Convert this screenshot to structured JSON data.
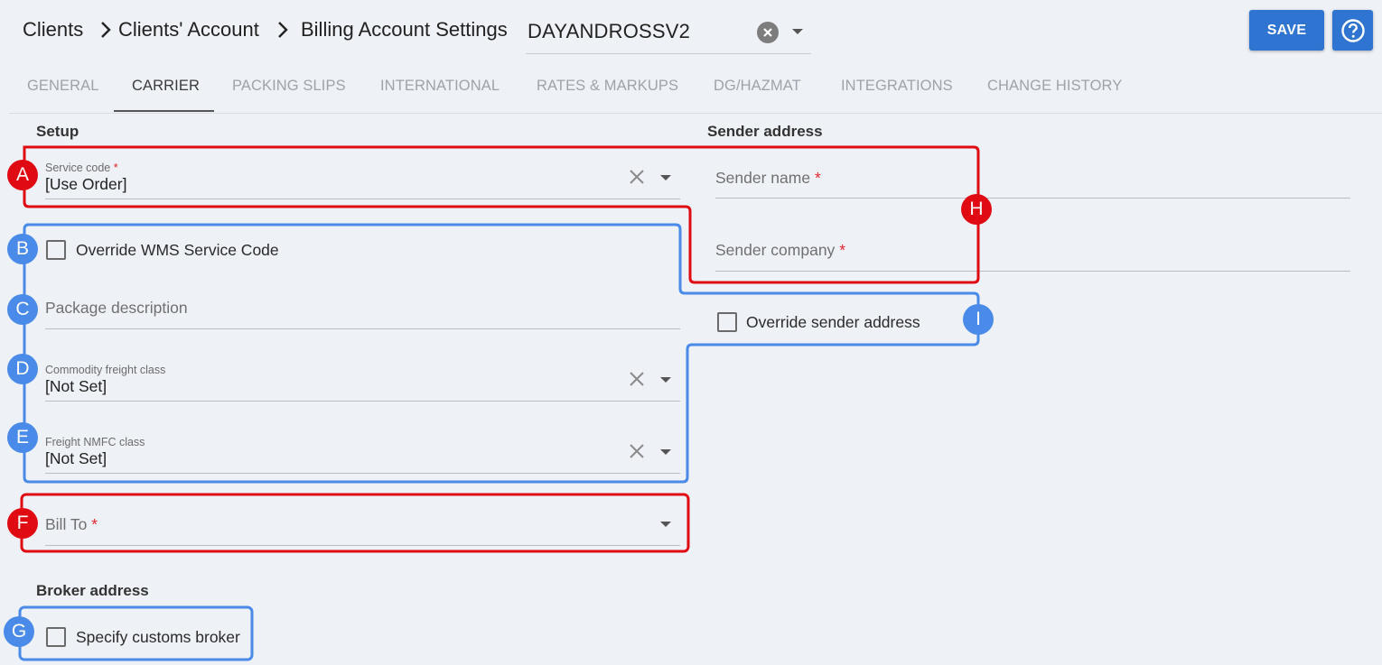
{
  "header": {
    "breadcrumb": [
      "Clients",
      "Clients' Account",
      "Billing Account Settings"
    ],
    "account_value": "DAYANDROSSV2",
    "save_label": "SAVE"
  },
  "tabs": [
    {
      "label": "GENERAL"
    },
    {
      "label": "CARRIER"
    },
    {
      "label": "PACKING SLIPS"
    },
    {
      "label": "INTERNATIONAL"
    },
    {
      "label": "RATES & MARKUPS"
    },
    {
      "label": "DG/HAZMAT"
    },
    {
      "label": "INTEGRATIONS"
    },
    {
      "label": "CHANGE HISTORY"
    }
  ],
  "active_tab": "CARRIER",
  "setup": {
    "title": "Setup",
    "service_code": {
      "label": "Service code",
      "required_mark": "*",
      "value": "[Use Order]"
    },
    "override_wms": {
      "label": "Override WMS Service Code",
      "checked": false
    },
    "package_description": {
      "placeholder": "Package description"
    },
    "commodity_freight_class": {
      "label": "Commodity freight class",
      "value": "[Not Set]"
    },
    "freight_nmfc_class": {
      "label": "Freight NMFC class",
      "value": "[Not Set]"
    },
    "bill_to": {
      "placeholder": "Bill To",
      "required_mark": "*"
    }
  },
  "broker": {
    "title": "Broker address",
    "specify_customs_broker": {
      "label": "Specify customs broker",
      "checked": false
    }
  },
  "sender": {
    "title": "Sender address",
    "sender_name": {
      "placeholder": "Sender name",
      "required_mark": "*"
    },
    "sender_company": {
      "placeholder": "Sender company",
      "required_mark": "*"
    },
    "override_sender_address": {
      "label": "Override sender address",
      "checked": false
    }
  },
  "annotations": {
    "colors": {
      "required_group": "#e00a12",
      "optional_group": "#4a8ae8"
    },
    "markers": [
      "A",
      "B",
      "C",
      "D",
      "E",
      "F",
      "G",
      "H",
      "I"
    ]
  }
}
